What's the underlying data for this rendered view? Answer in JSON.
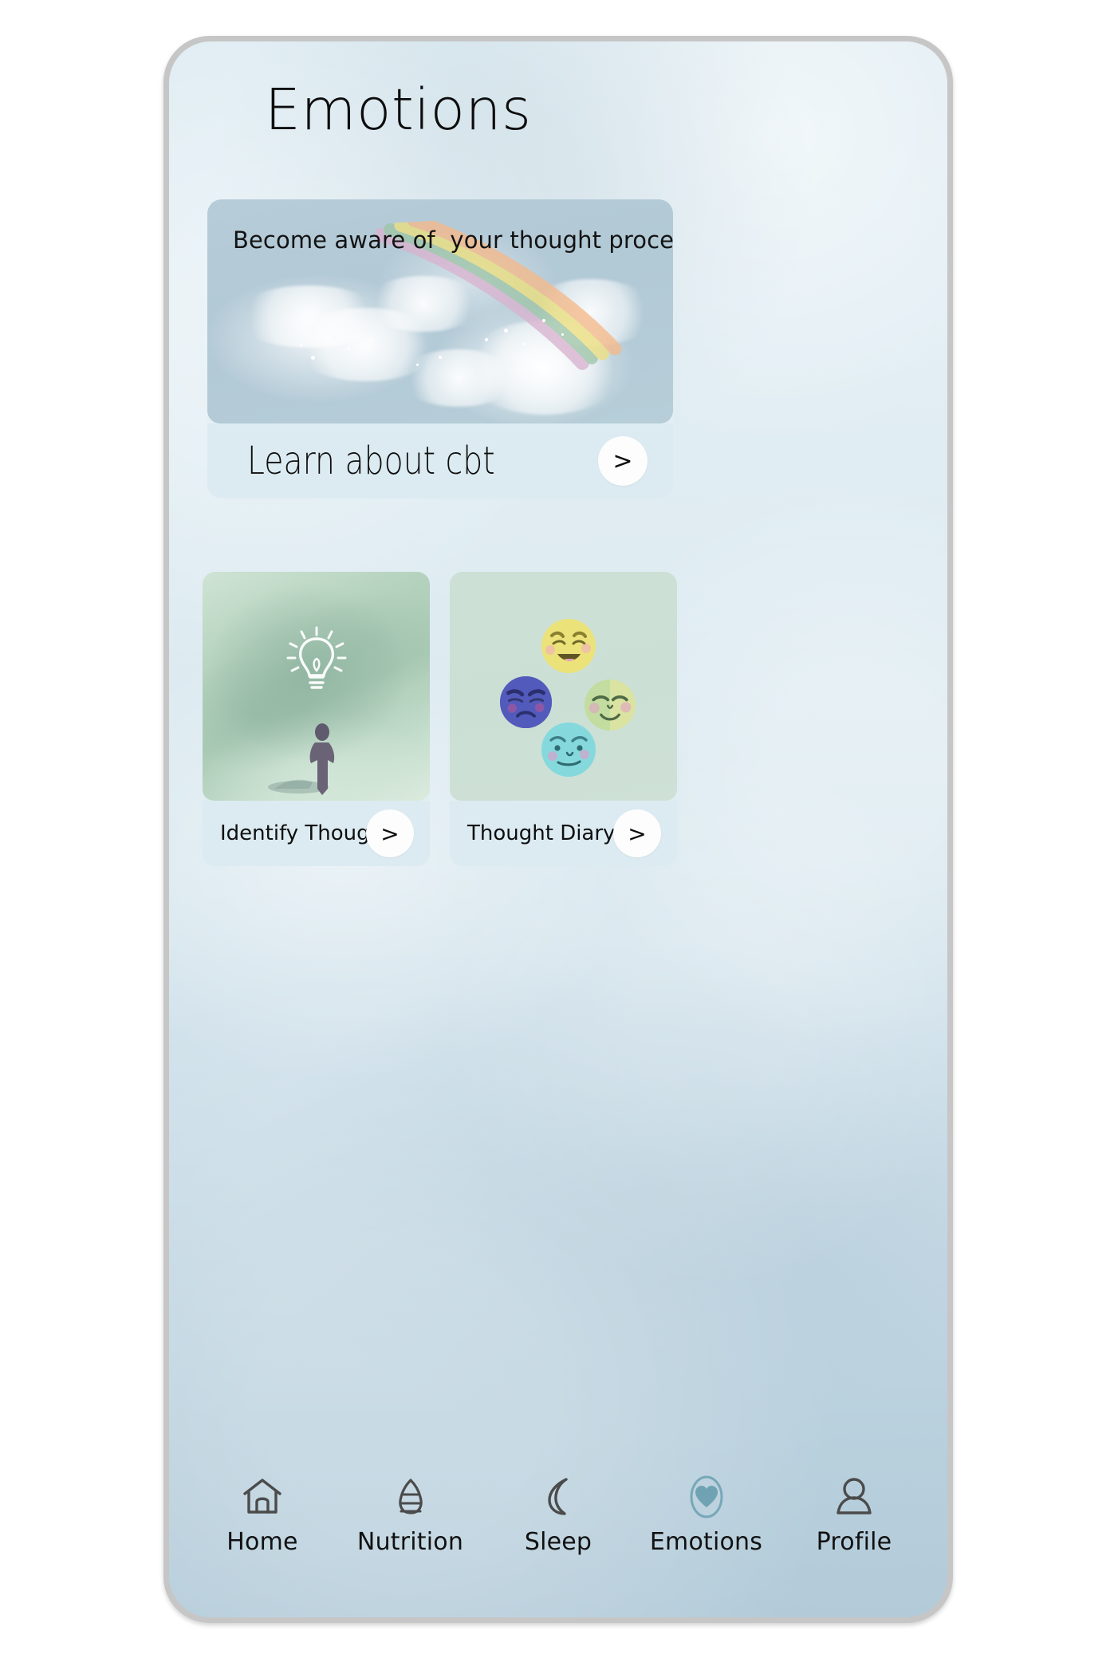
{
  "app": {
    "screen_title": "Emotions",
    "accent_color": "#5e93a4",
    "screen_bg_top": "#e0edf3",
    "screen_bg_bottom": "#b3cbd9",
    "card_bg": "#dcebf1",
    "banner_bg": "#b5cbd7"
  },
  "cbt_card": {
    "banner_text": "Become aware of  your thought process",
    "banner_art": "rainbow-clouds-illustration",
    "row_label": "Learn about cbt",
    "chevron": ">"
  },
  "tiles": [
    {
      "label": "Identify Thoughts",
      "chevron": ">",
      "art": "person-with-lightbulb-illustration",
      "art_bg": "#b4d2bd"
    },
    {
      "label": "Thought Diary",
      "chevron": ">",
      "art": "four-emotion-faces-illustration",
      "art_bg": "#cde0d6",
      "faces": [
        {
          "name": "happy-face",
          "color": "#ece27a"
        },
        {
          "name": "sad-face",
          "color": "#4a52b4"
        },
        {
          "name": "content-face",
          "color": "#c2dd9f"
        },
        {
          "name": "neutral-face",
          "color": "#8adde0"
        }
      ]
    }
  ],
  "bottom_nav": {
    "active_index": 3,
    "items": [
      {
        "label": "Home",
        "icon": "home-icon"
      },
      {
        "label": "Nutrition",
        "icon": "nutrition-icon"
      },
      {
        "label": "Sleep",
        "icon": "moon-icon"
      },
      {
        "label": "Emotions",
        "icon": "heart-icon"
      },
      {
        "label": "Profile",
        "icon": "person-icon"
      }
    ]
  }
}
